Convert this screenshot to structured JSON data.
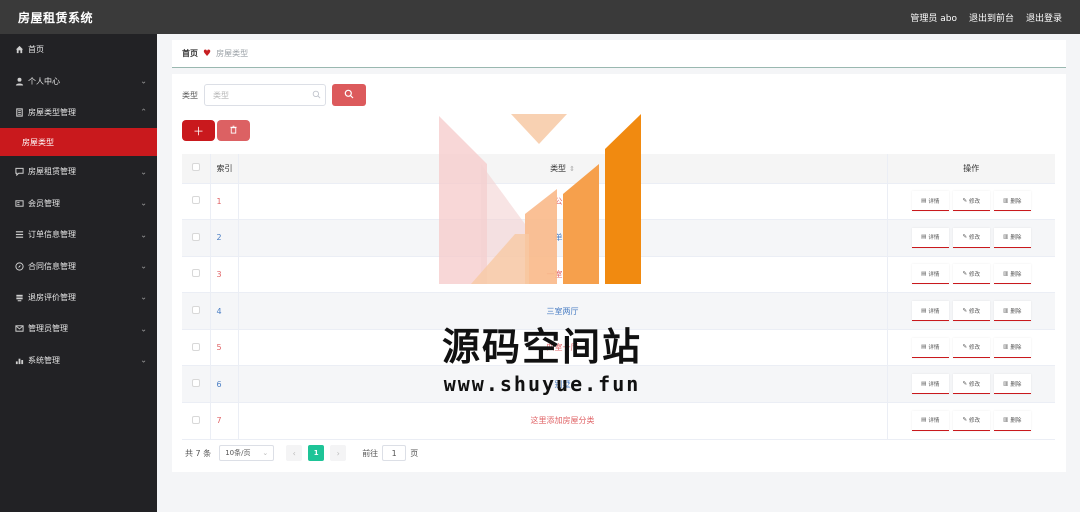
{
  "app": {
    "title": "房屋租赁系统",
    "user_label": "管理员 abo",
    "back_front": "退出到前台",
    "logout": "退出登录"
  },
  "sidebar": {
    "items": [
      {
        "label": "首页",
        "icon": "home-icon",
        "has_arrow": false
      },
      {
        "label": "个人中心",
        "icon": "user-icon",
        "has_arrow": true
      },
      {
        "label": "房屋类型管理",
        "icon": "building-icon",
        "has_arrow": true,
        "expanded": true
      },
      {
        "label": "房屋租赁管理",
        "icon": "chat-icon",
        "has_arrow": true
      },
      {
        "label": "会员管理",
        "icon": "card-icon",
        "has_arrow": true
      },
      {
        "label": "订单信息管理",
        "icon": "list-icon",
        "has_arrow": true
      },
      {
        "label": "合同信息管理",
        "icon": "compass-icon",
        "has_arrow": true
      },
      {
        "label": "退房评价管理",
        "icon": "stack-icon",
        "has_arrow": true
      },
      {
        "label": "管理员管理",
        "icon": "mail-icon",
        "has_arrow": true
      },
      {
        "label": "系统管理",
        "icon": "chart-icon",
        "has_arrow": true
      }
    ],
    "active_sub": "房屋类型"
  },
  "breadcrumb": {
    "home": "首页",
    "current": "房屋类型"
  },
  "search": {
    "label": "类型",
    "placeholder": "类型"
  },
  "table": {
    "headers": {
      "index": "索引",
      "type": "类型",
      "ops": "操作"
    },
    "op_labels": {
      "detail": "详情",
      "edit": "修改",
      "delete": "删除"
    },
    "rows": [
      {
        "index": "1",
        "type": "公寓"
      },
      {
        "index": "2",
        "type": "单间"
      },
      {
        "index": "3",
        "type": "一室一厅"
      },
      {
        "index": "4",
        "type": "三室两厅"
      },
      {
        "index": "5",
        "type": "四室一厅"
      },
      {
        "index": "6",
        "type": "别墅"
      },
      {
        "index": "7",
        "type": "这里添加房屋分类"
      }
    ]
  },
  "pagination": {
    "total": "共 7 条",
    "page_size": "10条/页",
    "current": "1",
    "goto_prefix": "前往",
    "goto_value": "1",
    "goto_suffix": "页"
  },
  "watermark": {
    "title": "源码空间站",
    "url": "www.shuyue.fun"
  },
  "colors": {
    "accent": "#c9191d",
    "header_bg": "#3a3a3a",
    "sidebar_bg": "#222225",
    "page_active": "#1ec497"
  }
}
